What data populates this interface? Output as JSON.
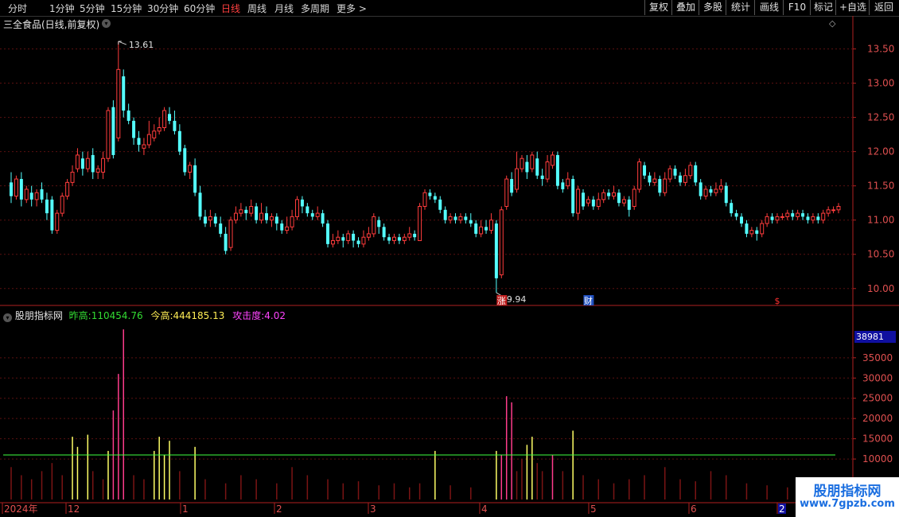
{
  "toolbar": {
    "timeframes": [
      "分时",
      "1分钟",
      "5分钟",
      "15分钟",
      "30分钟",
      "60分钟",
      "日线",
      "周线",
      "月线",
      "多周期",
      "更多"
    ],
    "active": "日线",
    "more_arrow": ">",
    "right_buttons": [
      "复权",
      "叠加",
      "多股",
      "统计",
      "画线",
      "F10",
      "+自选",
      "返回"
    ],
    "mark_button": "标记"
  },
  "main_panel": {
    "title": "三全食品(日线,前复权)",
    "high_label": "13.61",
    "low_label": "9.94",
    "y_ticks": [
      "13.50",
      "13.00",
      "12.50",
      "12.00",
      "11.50",
      "11.00",
      "10.50",
      "10.00"
    ],
    "event_markers": [
      "涨",
      "财",
      "$"
    ]
  },
  "sub_panel": {
    "name": "股朋指标网",
    "prev_high_label": "昨高:",
    "prev_high_value": "110454.76",
    "today_high_label": "今高:",
    "today_high_value": "444185.13",
    "attack_label": "攻击度:",
    "attack_value": "4.02",
    "current_value": "38981",
    "y_ticks": [
      "35000",
      "30000",
      "25000",
      "20000",
      "15000",
      "10000"
    ]
  },
  "x_axis": {
    "labels": [
      "2024年",
      "12",
      "1",
      "2",
      "3",
      "4",
      "5",
      "6",
      "2"
    ]
  },
  "watermark": {
    "name": "股朋指标网",
    "url": "www.7gpzb.com"
  },
  "colors": {
    "up": "#ff3c3c",
    "down": "#54ffff",
    "axis": "#b02020",
    "grid": "#5a1010",
    "threshold_line": "#40ff40",
    "bar_magenta": "#ff3c8c",
    "bar_yellow": "#ffff66",
    "bar_dark": "#7a1414"
  },
  "chart_data": {
    "type": "candlestick",
    "ylim": [
      9.8,
      13.75
    ],
    "candles": [
      [
        11.55,
        11.35,
        11.7,
        11.25
      ],
      [
        11.35,
        11.6,
        11.65,
        11.3
      ],
      [
        11.6,
        11.3,
        11.7,
        11.2
      ],
      [
        11.3,
        11.45,
        11.5,
        11.25
      ],
      [
        11.4,
        11.3,
        11.5,
        11.2
      ],
      [
        11.3,
        11.4,
        11.45,
        11.2
      ],
      [
        11.45,
        11.3,
        11.55,
        11.25
      ],
      [
        11.3,
        11.1,
        11.4,
        11.0
      ],
      [
        11.3,
        10.85,
        11.35,
        10.8
      ],
      [
        10.85,
        11.1,
        11.15,
        10.8
      ],
      [
        11.1,
        11.35,
        11.4,
        11.05
      ],
      [
        11.35,
        11.55,
        11.6,
        11.3
      ],
      [
        11.55,
        11.7,
        11.8,
        11.5
      ],
      [
        11.75,
        11.95,
        12.05,
        11.7
      ],
      [
        11.9,
        11.75,
        12.0,
        11.65
      ],
      [
        11.75,
        11.9,
        12.0,
        11.7
      ],
      [
        11.95,
        11.7,
        12.05,
        11.6
      ],
      [
        11.7,
        11.75,
        11.8,
        11.6
      ],
      [
        11.7,
        11.9,
        12.0,
        11.6
      ],
      [
        11.9,
        12.6,
        12.65,
        11.85
      ],
      [
        12.65,
        11.95,
        12.75,
        11.9
      ],
      [
        12.2,
        13.2,
        13.61,
        12.15
      ],
      [
        13.1,
        12.6,
        13.2,
        12.5
      ],
      [
        12.6,
        12.45,
        12.7,
        12.4
      ],
      [
        12.45,
        12.2,
        12.5,
        12.1
      ],
      [
        12.2,
        12.1,
        12.3,
        12.0
      ],
      [
        12.05,
        12.1,
        12.2,
        11.95
      ],
      [
        12.1,
        12.25,
        12.45,
        12.05
      ],
      [
        12.2,
        12.3,
        12.4,
        12.15
      ],
      [
        12.3,
        12.35,
        12.5,
        12.25
      ],
      [
        12.35,
        12.6,
        12.65,
        12.3
      ],
      [
        12.55,
        12.45,
        12.65,
        12.4
      ],
      [
        12.45,
        12.3,
        12.6,
        12.25
      ],
      [
        12.3,
        12.0,
        12.4,
        11.95
      ],
      [
        12.05,
        11.7,
        12.1,
        11.65
      ],
      [
        11.7,
        11.8,
        11.85,
        11.6
      ],
      [
        11.8,
        11.4,
        11.9,
        11.35
      ],
      [
        11.4,
        11.05,
        11.5,
        11.0
      ],
      [
        11.05,
        10.95,
        11.15,
        10.9
      ],
      [
        11.0,
        11.05,
        11.15,
        10.9
      ],
      [
        11.05,
        10.95,
        11.1,
        10.9
      ],
      [
        10.95,
        10.8,
        11.05,
        10.75
      ],
      [
        10.8,
        10.55,
        10.9,
        10.5
      ],
      [
        10.6,
        11.0,
        11.05,
        10.55
      ],
      [
        11.0,
        11.1,
        11.2,
        10.95
      ],
      [
        11.1,
        11.15,
        11.25,
        11.05
      ],
      [
        11.15,
        11.1,
        11.2,
        11.0
      ],
      [
        11.1,
        11.2,
        11.3,
        11.05
      ],
      [
        11.2,
        11.0,
        11.25,
        10.95
      ],
      [
        11.0,
        11.1,
        11.25,
        10.95
      ],
      [
        11.1,
        11.0,
        11.2,
        10.95
      ],
      [
        11.0,
        11.05,
        11.1,
        10.9
      ],
      [
        11.05,
        10.95,
        11.1,
        10.85
      ],
      [
        10.95,
        10.85,
        11.0,
        10.8
      ],
      [
        10.85,
        10.9,
        11.05,
        10.8
      ],
      [
        10.9,
        11.05,
        11.15,
        10.85
      ],
      [
        11.05,
        11.3,
        11.35,
        11.0
      ],
      [
        11.3,
        11.2,
        11.35,
        11.1
      ],
      [
        11.2,
        11.1,
        11.25,
        11.05
      ],
      [
        11.1,
        11.05,
        11.15,
        11.0
      ],
      [
        11.05,
        11.1,
        11.2,
        11.0
      ],
      [
        11.1,
        10.95,
        11.15,
        10.9
      ],
      [
        10.95,
        10.65,
        11.0,
        10.6
      ],
      [
        10.65,
        10.7,
        10.8,
        10.6
      ],
      [
        10.7,
        10.75,
        10.85,
        10.65
      ],
      [
        10.75,
        10.7,
        10.8,
        10.6
      ],
      [
        10.7,
        10.8,
        10.85,
        10.65
      ],
      [
        10.8,
        10.7,
        10.85,
        10.6
      ],
      [
        10.7,
        10.65,
        10.75,
        10.6
      ],
      [
        10.65,
        10.75,
        10.85,
        10.6
      ],
      [
        10.75,
        10.8,
        10.9,
        10.7
      ],
      [
        10.8,
        11.05,
        11.1,
        10.75
      ],
      [
        11.0,
        10.9,
        11.05,
        10.8
      ],
      [
        10.9,
        10.75,
        10.95,
        10.7
      ],
      [
        10.75,
        10.7,
        10.8,
        10.65
      ],
      [
        10.7,
        10.75,
        10.8,
        10.65
      ],
      [
        10.75,
        10.7,
        10.8,
        10.65
      ],
      [
        10.7,
        10.75,
        10.8,
        10.65
      ],
      [
        10.75,
        10.8,
        10.9,
        10.7
      ],
      [
        10.8,
        10.75,
        10.85,
        10.7
      ],
      [
        10.7,
        11.2,
        11.25,
        10.7
      ],
      [
        11.2,
        11.4,
        11.45,
        11.15
      ],
      [
        11.4,
        11.35,
        11.45,
        11.3
      ],
      [
        11.35,
        11.3,
        11.4,
        11.25
      ],
      [
        11.3,
        11.15,
        11.35,
        11.1
      ],
      [
        11.15,
        11.0,
        11.2,
        10.95
      ],
      [
        11.0,
        11.05,
        11.1,
        10.95
      ],
      [
        11.05,
        11.0,
        11.1,
        10.95
      ],
      [
        11.0,
        11.05,
        11.1,
        10.95
      ],
      [
        11.05,
        11.0,
        11.1,
        10.95
      ],
      [
        11.0,
        10.95,
        11.1,
        10.9
      ],
      [
        10.95,
        10.8,
        11.0,
        10.75
      ],
      [
        10.8,
        10.9,
        11.0,
        10.75
      ],
      [
        10.9,
        10.85,
        11.0,
        10.8
      ],
      [
        10.85,
        11.0,
        11.1,
        10.8
      ],
      [
        10.95,
        10.15,
        11.0,
        9.94
      ],
      [
        10.2,
        11.15,
        11.2,
        10.15
      ],
      [
        11.2,
        11.6,
        11.65,
        11.15
      ],
      [
        11.6,
        11.4,
        11.7,
        11.35
      ],
      [
        11.45,
        11.75,
        12.0,
        11.4
      ],
      [
        11.75,
        11.9,
        11.95,
        11.7
      ],
      [
        11.85,
        11.7,
        11.95,
        11.6
      ],
      [
        11.75,
        11.95,
        12.0,
        11.7
      ],
      [
        11.9,
        11.65,
        12.0,
        11.6
      ],
      [
        11.65,
        11.6,
        11.75,
        11.5
      ],
      [
        11.6,
        11.85,
        11.95,
        11.55
      ],
      [
        11.8,
        11.95,
        12.0,
        11.75
      ],
      [
        11.95,
        11.5,
        12.0,
        11.45
      ],
      [
        11.55,
        11.45,
        11.6,
        11.4
      ],
      [
        11.5,
        11.6,
        11.7,
        11.45
      ],
      [
        11.6,
        11.1,
        11.65,
        11.05
      ],
      [
        11.1,
        11.45,
        11.5,
        11.0
      ],
      [
        11.4,
        11.2,
        11.45,
        11.15
      ],
      [
        11.25,
        11.3,
        11.35,
        11.2
      ],
      [
        11.3,
        11.2,
        11.35,
        11.15
      ],
      [
        11.2,
        11.3,
        11.4,
        11.15
      ],
      [
        11.3,
        11.4,
        11.45,
        11.25
      ],
      [
        11.4,
        11.35,
        11.45,
        11.3
      ],
      [
        11.35,
        11.4,
        11.5,
        11.3
      ],
      [
        11.4,
        11.25,
        11.45,
        11.2
      ],
      [
        11.25,
        11.3,
        11.35,
        11.2
      ],
      [
        11.3,
        11.15,
        11.35,
        11.05
      ],
      [
        11.2,
        11.45,
        11.5,
        11.15
      ],
      [
        11.45,
        11.85,
        11.9,
        11.4
      ],
      [
        11.8,
        11.65,
        11.85,
        11.6
      ],
      [
        11.65,
        11.55,
        11.7,
        11.5
      ],
      [
        11.55,
        11.6,
        11.7,
        11.5
      ],
      [
        11.6,
        11.4,
        11.65,
        11.35
      ],
      [
        11.4,
        11.6,
        11.7,
        11.35
      ],
      [
        11.6,
        11.75,
        11.8,
        11.55
      ],
      [
        11.75,
        11.65,
        11.8,
        11.6
      ],
      [
        11.65,
        11.55,
        11.7,
        11.5
      ],
      [
        11.55,
        11.65,
        11.75,
        11.5
      ],
      [
        11.65,
        11.8,
        11.85,
        11.6
      ],
      [
        11.8,
        11.55,
        11.85,
        11.5
      ],
      [
        11.55,
        11.35,
        11.6,
        11.3
      ],
      [
        11.35,
        11.45,
        11.5,
        11.3
      ],
      [
        11.45,
        11.4,
        11.5,
        11.35
      ],
      [
        11.4,
        11.45,
        11.55,
        11.35
      ],
      [
        11.45,
        11.5,
        11.6,
        11.4
      ],
      [
        11.5,
        11.25,
        11.55,
        11.2
      ],
      [
        11.25,
        11.1,
        11.3,
        11.05
      ],
      [
        11.1,
        11.05,
        11.15,
        11.0
      ],
      [
        11.05,
        10.95,
        11.1,
        10.9
      ],
      [
        10.95,
        10.8,
        11.0,
        10.75
      ],
      [
        10.8,
        10.85,
        10.9,
        10.75
      ],
      [
        10.85,
        10.8,
        10.9,
        10.7
      ],
      [
        10.8,
        10.95,
        11.0,
        10.75
      ],
      [
        10.95,
        11.05,
        11.1,
        10.9
      ],
      [
        11.05,
        11.0,
        11.1,
        10.95
      ],
      [
        11.0,
        11.05,
        11.1,
        10.95
      ],
      [
        11.05,
        11.05,
        11.1,
        11.0
      ],
      [
        11.05,
        11.1,
        11.15,
        11.0
      ],
      [
        11.1,
        11.05,
        11.15,
        11.0
      ],
      [
        11.05,
        11.1,
        11.15,
        11.0
      ],
      [
        11.1,
        11.05,
        11.15,
        11.0
      ],
      [
        11.05,
        11.0,
        11.1,
        10.95
      ],
      [
        11.0,
        11.05,
        11.1,
        10.95
      ],
      [
        11.05,
        11.0,
        11.1,
        10.95
      ],
      [
        11.0,
        11.1,
        11.15,
        10.95
      ],
      [
        11.1,
        11.15,
        11.2,
        11.05
      ],
      [
        11.15,
        11.15,
        11.2,
        11.1
      ],
      [
        11.15,
        11.2,
        11.25,
        11.1
      ]
    ],
    "indicator": {
      "ylim": [
        0,
        44000
      ],
      "threshold": 11000,
      "bars": [
        {
          "i": 0,
          "v": 8000,
          "c": "dark"
        },
        {
          "i": 2,
          "v": 6000,
          "c": "dark"
        },
        {
          "i": 4,
          "v": 5000,
          "c": "dark"
        },
        {
          "i": 6,
          "v": 7000,
          "c": "dark"
        },
        {
          "i": 8,
          "v": 9000,
          "c": "dark"
        },
        {
          "i": 10,
          "v": 6000,
          "c": "dark"
        },
        {
          "i": 12,
          "v": 15500,
          "c": "yellow"
        },
        {
          "i": 13,
          "v": 13000,
          "c": "yellow"
        },
        {
          "i": 15,
          "v": 16000,
          "c": "yellow"
        },
        {
          "i": 16,
          "v": 7000,
          "c": "dark"
        },
        {
          "i": 18,
          "v": 5000,
          "c": "dark"
        },
        {
          "i": 19,
          "v": 12000,
          "c": "yellow"
        },
        {
          "i": 20,
          "v": 22000,
          "c": "magenta"
        },
        {
          "i": 21,
          "v": 31000,
          "c": "magenta"
        },
        {
          "i": 22,
          "v": 42000,
          "c": "magenta"
        },
        {
          "i": 24,
          "v": 6000,
          "c": "dark"
        },
        {
          "i": 26,
          "v": 5000,
          "c": "dark"
        },
        {
          "i": 28,
          "v": 12000,
          "c": "yellow"
        },
        {
          "i": 29,
          "v": 15500,
          "c": "yellow"
        },
        {
          "i": 30,
          "v": 11000,
          "c": "yellow"
        },
        {
          "i": 31,
          "v": 14500,
          "c": "yellow"
        },
        {
          "i": 33,
          "v": 7000,
          "c": "dark"
        },
        {
          "i": 36,
          "v": 13000,
          "c": "yellow"
        },
        {
          "i": 38,
          "v": 5000,
          "c": "dark"
        },
        {
          "i": 42,
          "v": 4000,
          "c": "dark"
        },
        {
          "i": 45,
          "v": 6000,
          "c": "dark"
        },
        {
          "i": 48,
          "v": 5000,
          "c": "dark"
        },
        {
          "i": 52,
          "v": 4000,
          "c": "dark"
        },
        {
          "i": 55,
          "v": 8000,
          "c": "dark"
        },
        {
          "i": 58,
          "v": 6000,
          "c": "dark"
        },
        {
          "i": 62,
          "v": 5000,
          "c": "dark"
        },
        {
          "i": 65,
          "v": 4000,
          "c": "dark"
        },
        {
          "i": 68,
          "v": 4500,
          "c": "dark"
        },
        {
          "i": 72,
          "v": 3500,
          "c": "dark"
        },
        {
          "i": 75,
          "v": 4000,
          "c": "dark"
        },
        {
          "i": 78,
          "v": 3000,
          "c": "dark"
        },
        {
          "i": 80,
          "v": 4000,
          "c": "dark"
        },
        {
          "i": 83,
          "v": 12000,
          "c": "yellow"
        },
        {
          "i": 86,
          "v": 3500,
          "c": "dark"
        },
        {
          "i": 90,
          "v": 3000,
          "c": "dark"
        },
        {
          "i": 95,
          "v": 12000,
          "c": "yellow"
        },
        {
          "i": 96,
          "v": 11000,
          "c": "magenta"
        },
        {
          "i": 97,
          "v": 25500,
          "c": "magenta"
        },
        {
          "i": 98,
          "v": 24000,
          "c": "magenta"
        },
        {
          "i": 99,
          "v": 7000,
          "c": "dark"
        },
        {
          "i": 100,
          "v": 10000,
          "c": "dark"
        },
        {
          "i": 101,
          "v": 13500,
          "c": "yellow"
        },
        {
          "i": 102,
          "v": 15500,
          "c": "yellow"
        },
        {
          "i": 103,
          "v": 9000,
          "c": "dark"
        },
        {
          "i": 104,
          "v": 7000,
          "c": "dark"
        },
        {
          "i": 106,
          "v": 11000,
          "c": "magenta"
        },
        {
          "i": 108,
          "v": 7000,
          "c": "dark"
        },
        {
          "i": 110,
          "v": 17000,
          "c": "yellow"
        },
        {
          "i": 112,
          "v": 6000,
          "c": "dark"
        },
        {
          "i": 115,
          "v": 5000,
          "c": "dark"
        },
        {
          "i": 118,
          "v": 4000,
          "c": "dark"
        },
        {
          "i": 121,
          "v": 5000,
          "c": "dark"
        },
        {
          "i": 124,
          "v": 6000,
          "c": "dark"
        },
        {
          "i": 128,
          "v": 8000,
          "c": "dark"
        },
        {
          "i": 131,
          "v": 5000,
          "c": "dark"
        },
        {
          "i": 134,
          "v": 4500,
          "c": "dark"
        },
        {
          "i": 137,
          "v": 7000,
          "c": "dark"
        },
        {
          "i": 140,
          "v": 6000,
          "c": "dark"
        },
        {
          "i": 144,
          "v": 4000,
          "c": "dark"
        },
        {
          "i": 148,
          "v": 3500,
          "c": "dark"
        },
        {
          "i": 152,
          "v": 3000,
          "c": "dark"
        },
        {
          "i": 156,
          "v": 4000,
          "c": "dark"
        },
        {
          "i": 158,
          "v": 3500,
          "c": "dark"
        }
      ]
    }
  }
}
